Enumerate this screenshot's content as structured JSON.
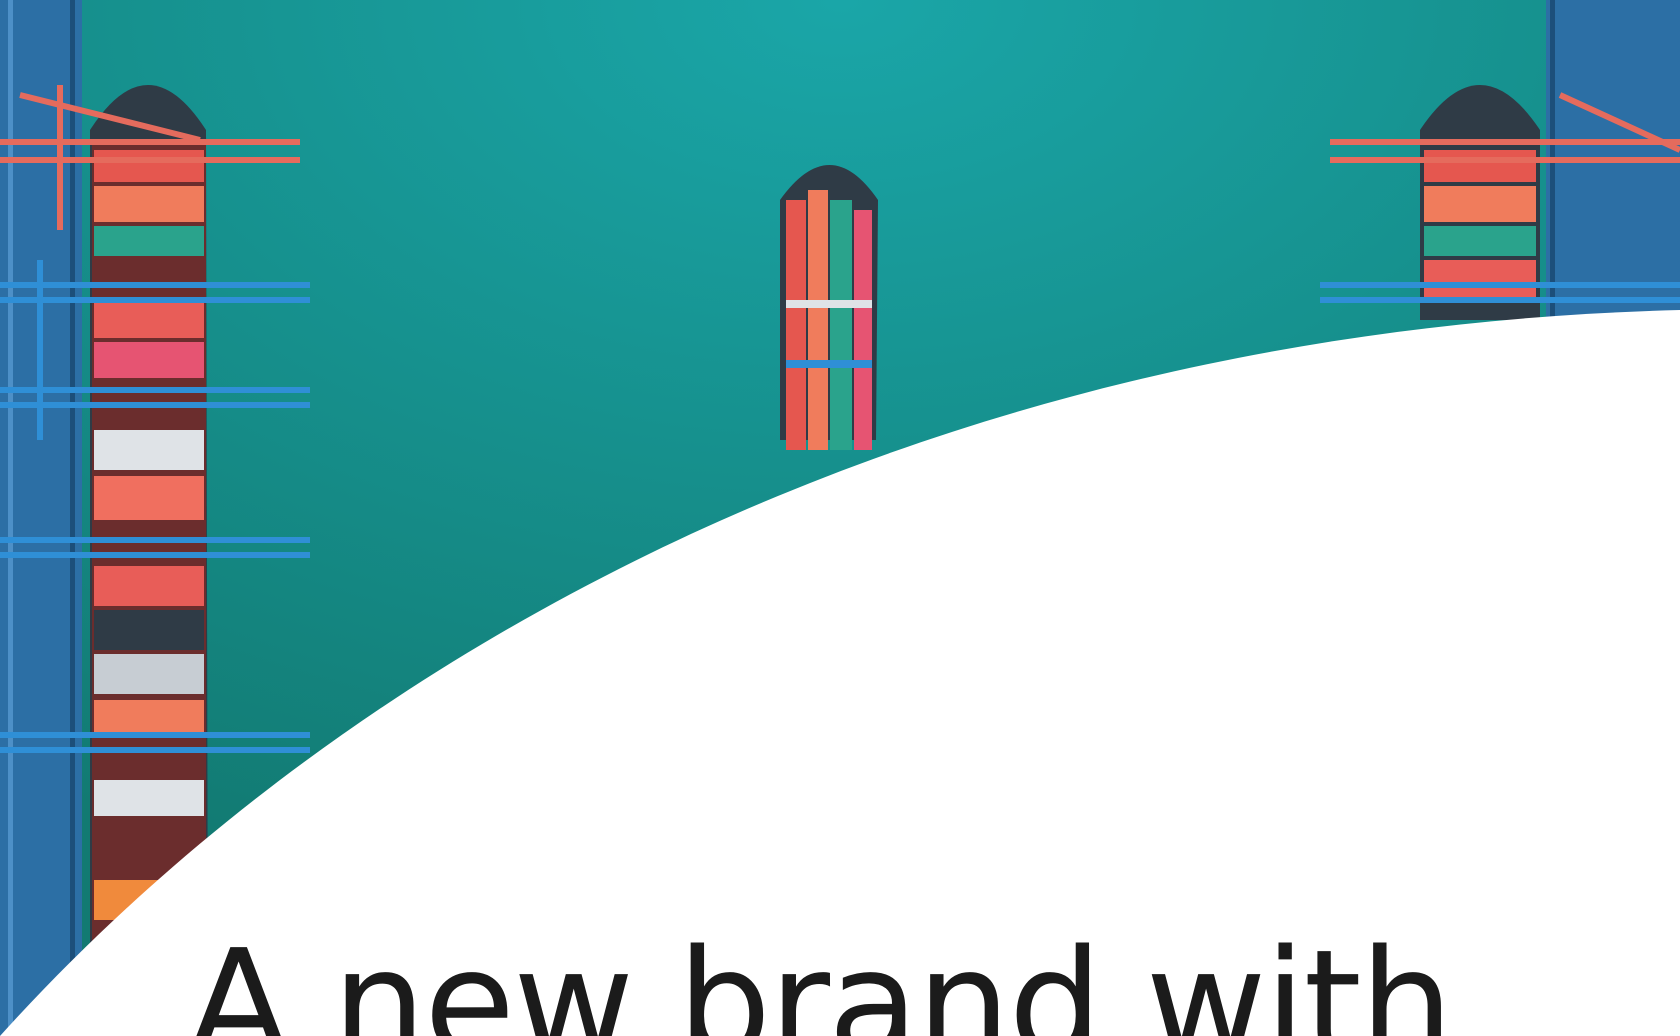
{
  "hero": {
    "headline": "A new brand with",
    "colors": {
      "water": "#127a72",
      "water_light": "#1aa6a8",
      "dock": "#2c6fa5",
      "crane_blue": "#2f8fd6",
      "crane_red": "#e56b5d",
      "hull": "#2f3b46",
      "paper": "#ffffff",
      "ink": "#1b1b1b"
    }
  }
}
